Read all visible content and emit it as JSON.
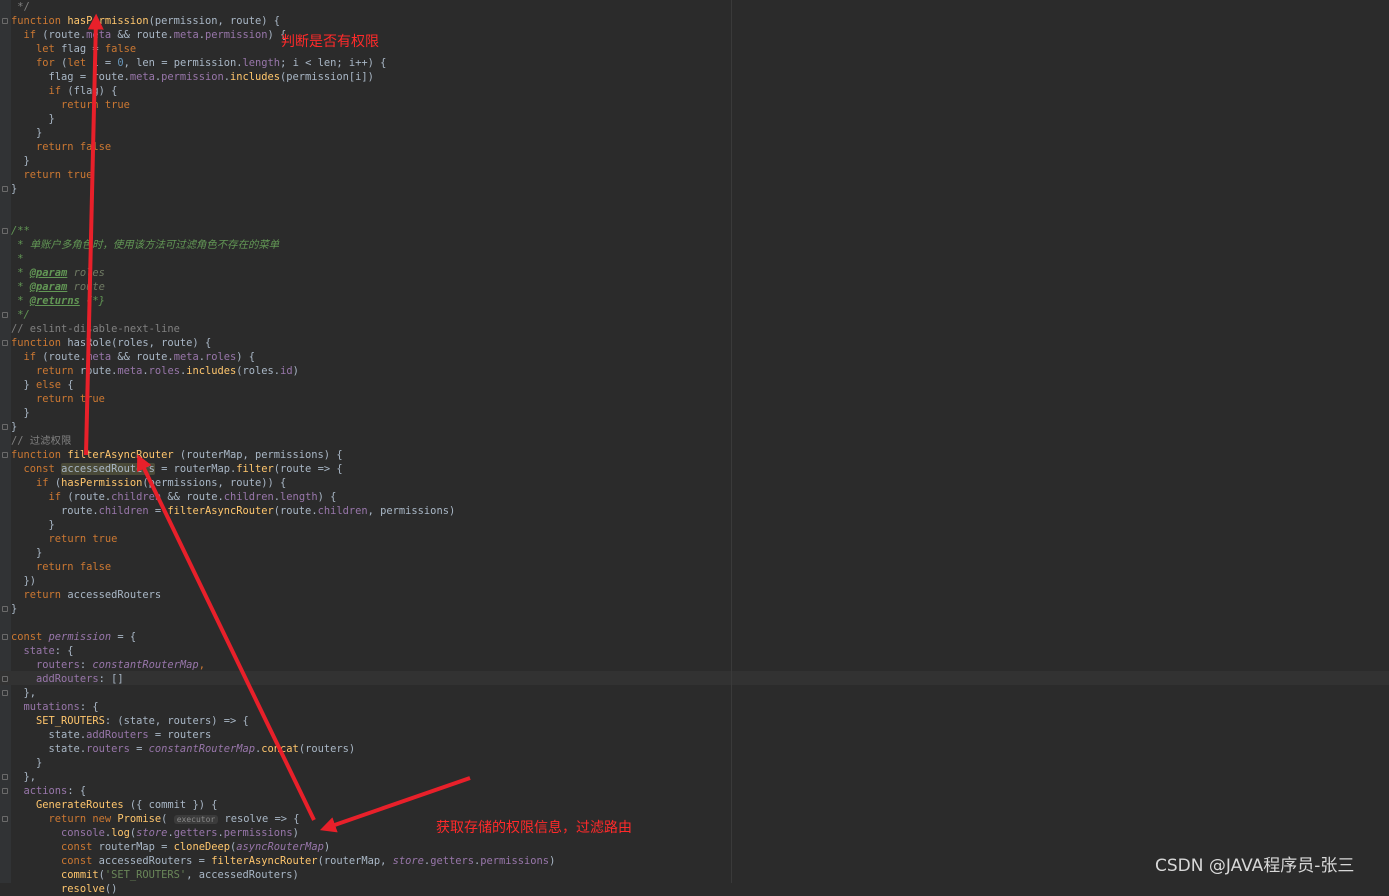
{
  "code_lines": [
    [
      [
        "cm",
        " */"
      ]
    ],
    [
      [
        "kw",
        "function "
      ],
      [
        "fn",
        "hasPermission"
      ],
      [
        "",
        "(permission, route) {"
      ]
    ],
    [
      [
        "",
        "  "
      ],
      [
        "kw",
        "if "
      ],
      [
        "",
        "(route."
      ],
      [
        "prop",
        "meta"
      ],
      [
        "",
        " && route."
      ],
      [
        "prop",
        "meta"
      ],
      [
        "",
        "."
      ],
      [
        "prop",
        "permission"
      ],
      [
        "",
        ") {"
      ]
    ],
    [
      [
        "",
        "    "
      ],
      [
        "kw",
        "let "
      ],
      [
        "",
        "flag = "
      ],
      [
        "kw",
        "false"
      ]
    ],
    [
      [
        "",
        "    "
      ],
      [
        "kw",
        "for "
      ],
      [
        "",
        "("
      ],
      [
        "kw",
        "let "
      ],
      [
        "",
        "i = "
      ],
      [
        "num",
        "0"
      ],
      [
        "",
        ", len = permission."
      ],
      [
        "prop",
        "length"
      ],
      [
        "",
        "; i < len; i++) {"
      ]
    ],
    [
      [
        "",
        "      flag = route."
      ],
      [
        "prop",
        "meta"
      ],
      [
        "",
        "."
      ],
      [
        "prop",
        "permission"
      ],
      [
        "",
        "."
      ],
      [
        "fn",
        "includes"
      ],
      [
        "",
        "(permission[i])"
      ]
    ],
    [
      [
        "",
        "      "
      ],
      [
        "kw",
        "if "
      ],
      [
        "",
        "(flag) {"
      ]
    ],
    [
      [
        "",
        "        "
      ],
      [
        "kw",
        "return true"
      ]
    ],
    [
      [
        "",
        "      }"
      ]
    ],
    [
      [
        "",
        "    }"
      ]
    ],
    [
      [
        "",
        "    "
      ],
      [
        "kw",
        "return false"
      ]
    ],
    [
      [
        "",
        "  }"
      ]
    ],
    [
      [
        "",
        "  "
      ],
      [
        "kw",
        "return true"
      ]
    ],
    [
      [
        "",
        "}"
      ]
    ],
    [],
    [],
    [
      [
        "dc",
        "/**"
      ]
    ],
    [
      [
        "dc",
        " * 单账户多角色时，使用该方法可过滤角色不存在的菜单"
      ]
    ],
    [
      [
        "dc",
        " *"
      ]
    ],
    [
      [
        "dc",
        " * "
      ],
      [
        "dt",
        "@param"
      ],
      [
        "dp",
        " roles"
      ]
    ],
    [
      [
        "dc",
        " * "
      ],
      [
        "dt",
        "@param"
      ],
      [
        "dp",
        " route"
      ]
    ],
    [
      [
        "dc",
        " * "
      ],
      [
        "dt",
        "@returns"
      ],
      [
        "dc",
        " {*}"
      ]
    ],
    [
      [
        "dc",
        " */"
      ]
    ],
    [
      [
        "cm",
        "// eslint-disable-next-line"
      ]
    ],
    [
      [
        "kw",
        "function "
      ],
      [
        "",
        "hasRole(roles, route) {"
      ]
    ],
    [
      [
        "",
        "  "
      ],
      [
        "kw",
        "if "
      ],
      [
        "",
        "(route."
      ],
      [
        "prop",
        "meta"
      ],
      [
        "",
        " && route."
      ],
      [
        "prop",
        "meta"
      ],
      [
        "",
        "."
      ],
      [
        "prop",
        "roles"
      ],
      [
        "",
        ") {"
      ]
    ],
    [
      [
        "",
        "    "
      ],
      [
        "kw",
        "return "
      ],
      [
        "",
        "route."
      ],
      [
        "prop",
        "meta"
      ],
      [
        "",
        "."
      ],
      [
        "prop",
        "roles"
      ],
      [
        "",
        "."
      ],
      [
        "fn",
        "includes"
      ],
      [
        "",
        "(roles."
      ],
      [
        "prop",
        "id"
      ],
      [
        "",
        ")"
      ]
    ],
    [
      [
        "",
        "  } "
      ],
      [
        "kw",
        "else "
      ],
      [
        "",
        "{"
      ]
    ],
    [
      [
        "",
        "    "
      ],
      [
        "kw",
        "return true"
      ]
    ],
    [
      [
        "",
        "  }"
      ]
    ],
    [
      [
        "",
        "}"
      ]
    ],
    [
      [
        "cm",
        "// 过滤权限"
      ]
    ],
    [
      [
        "kw",
        "function "
      ],
      [
        "fn",
        "filterAsyncRouter"
      ],
      [
        "",
        " (routerMap, permissions) {"
      ]
    ],
    [
      [
        "",
        "  "
      ],
      [
        "kw",
        "const "
      ],
      [
        "hl",
        "accessedRouters"
      ],
      [
        "",
        " = routerMap."
      ],
      [
        "fn",
        "filter"
      ],
      [
        "",
        "(route => {"
      ]
    ],
    [
      [
        "",
        "    "
      ],
      [
        "kw",
        "if "
      ],
      [
        "",
        "("
      ],
      [
        "fn",
        "hasPermission"
      ],
      [
        "",
        "(permissions, route)) {"
      ]
    ],
    [
      [
        "",
        "      "
      ],
      [
        "kw",
        "if "
      ],
      [
        "",
        "(route."
      ],
      [
        "prop",
        "children"
      ],
      [
        "",
        " && route."
      ],
      [
        "prop",
        "children"
      ],
      [
        "",
        "."
      ],
      [
        "prop",
        "length"
      ],
      [
        "",
        ") {"
      ]
    ],
    [
      [
        "",
        "        route."
      ],
      [
        "prop",
        "children"
      ],
      [
        "",
        " = "
      ],
      [
        "fn",
        "filterAsyncRouter"
      ],
      [
        "",
        "(route."
      ],
      [
        "prop",
        "children"
      ],
      [
        "",
        ", permissions)"
      ]
    ],
    [
      [
        "",
        "      }"
      ]
    ],
    [
      [
        "",
        "      "
      ],
      [
        "kw",
        "return true"
      ]
    ],
    [
      [
        "",
        "    }"
      ]
    ],
    [
      [
        "",
        "    "
      ],
      [
        "kw",
        "return false"
      ]
    ],
    [
      [
        "",
        "  })"
      ]
    ],
    [
      [
        "",
        "  "
      ],
      [
        "kw",
        "return "
      ],
      [
        "",
        "accessedRouters"
      ]
    ],
    [
      [
        "",
        "}"
      ]
    ],
    [],
    [
      [
        "kw",
        "const "
      ],
      [
        "gl",
        "permission"
      ],
      [
        "",
        " = {"
      ]
    ],
    [
      [
        "",
        "  "
      ],
      [
        "prop",
        "state"
      ],
      [
        "",
        ": {"
      ]
    ],
    [
      [
        "",
        "    "
      ],
      [
        "prop",
        "routers"
      ],
      [
        "",
        ": "
      ],
      [
        "gl",
        "constantRouterMap"
      ],
      [
        "kw",
        ","
      ]
    ],
    [
      [
        "",
        "    "
      ],
      [
        "prop",
        "addRouters"
      ],
      [
        "",
        ": []"
      ]
    ],
    [
      [
        "",
        "  },"
      ]
    ],
    [
      [
        "",
        "  "
      ],
      [
        "prop",
        "mutations"
      ],
      [
        "",
        ": {"
      ]
    ],
    [
      [
        "",
        "    "
      ],
      [
        "fn",
        "SET_ROUTERS"
      ],
      [
        "",
        ": (state, routers) => {"
      ]
    ],
    [
      [
        "",
        "      state."
      ],
      [
        "prop",
        "addRouters"
      ],
      [
        "",
        " = routers"
      ]
    ],
    [
      [
        "",
        "      state."
      ],
      [
        "prop",
        "routers"
      ],
      [
        "",
        " = "
      ],
      [
        "gl",
        "constantRouterMap"
      ],
      [
        "",
        "."
      ],
      [
        "fn",
        "concat"
      ],
      [
        "",
        "(routers)"
      ]
    ],
    [
      [
        "",
        "    }"
      ]
    ],
    [
      [
        "",
        "  },"
      ]
    ],
    [
      [
        "",
        "  "
      ],
      [
        "prop",
        "actions"
      ],
      [
        "",
        ": {"
      ]
    ],
    [
      [
        "",
        "    "
      ],
      [
        "fn",
        "GenerateRoutes"
      ],
      [
        "",
        " ({ commit }) {"
      ]
    ],
    [
      [
        "",
        "      "
      ],
      [
        "kw",
        "return new "
      ],
      [
        "fn",
        "Promise"
      ],
      [
        "",
        "( "
      ],
      [
        "hint",
        "executor"
      ],
      [
        "",
        " resolve => {"
      ]
    ],
    [
      [
        "",
        "        "
      ],
      [
        "prop",
        "console"
      ],
      [
        "",
        "."
      ],
      [
        "fn",
        "log"
      ],
      [
        "",
        "("
      ],
      [
        "gl",
        "store"
      ],
      [
        "",
        "."
      ],
      [
        "prop",
        "getters"
      ],
      [
        "",
        "."
      ],
      [
        "prop",
        "permissions"
      ],
      [
        "",
        ")"
      ]
    ],
    [
      [
        "",
        "        "
      ],
      [
        "kw",
        "const "
      ],
      [
        "",
        "routerMap = "
      ],
      [
        "fn",
        "cloneDeep"
      ],
      [
        "",
        "("
      ],
      [
        "gl",
        "asyncRouterMap"
      ],
      [
        "",
        ")"
      ]
    ],
    [
      [
        "",
        "        "
      ],
      [
        "kw",
        "const "
      ],
      [
        "",
        "accessedRouters = "
      ],
      [
        "fn",
        "filterAsyncRouter"
      ],
      [
        "",
        "(routerMap, "
      ],
      [
        "gl",
        "store"
      ],
      [
        "",
        "."
      ],
      [
        "prop",
        "getters"
      ],
      [
        "",
        "."
      ],
      [
        "prop",
        "permissions"
      ],
      [
        "",
        ")"
      ]
    ],
    [
      [
        "",
        "        "
      ],
      [
        "fn",
        "commit"
      ],
      [
        "",
        "("
      ],
      [
        "str",
        "'SET_ROUTERS'"
      ],
      [
        "",
        ", accessedRouters)"
      ]
    ],
    [
      [
        "",
        "        "
      ],
      [
        "fn",
        "resolve"
      ],
      [
        "",
        "()"
      ]
    ]
  ],
  "fold_marker_lines": [
    1,
    13,
    16,
    22,
    24,
    30,
    32,
    43,
    45,
    48,
    49,
    55,
    56,
    58
  ],
  "annotations": {
    "check_permission": "判断是否有权限",
    "get_permissions_filter": "获取存储的权限信息，过滤路由"
  },
  "watermark": "CSDN @JAVA程序员-张三",
  "colors": {
    "editor_bg": "#2b2b2b",
    "keyword": "#cc7832",
    "function": "#ffc66d",
    "property": "#9876aa",
    "string": "#6a8759",
    "comment": "#808080",
    "annotation_red": "#e8202a"
  }
}
